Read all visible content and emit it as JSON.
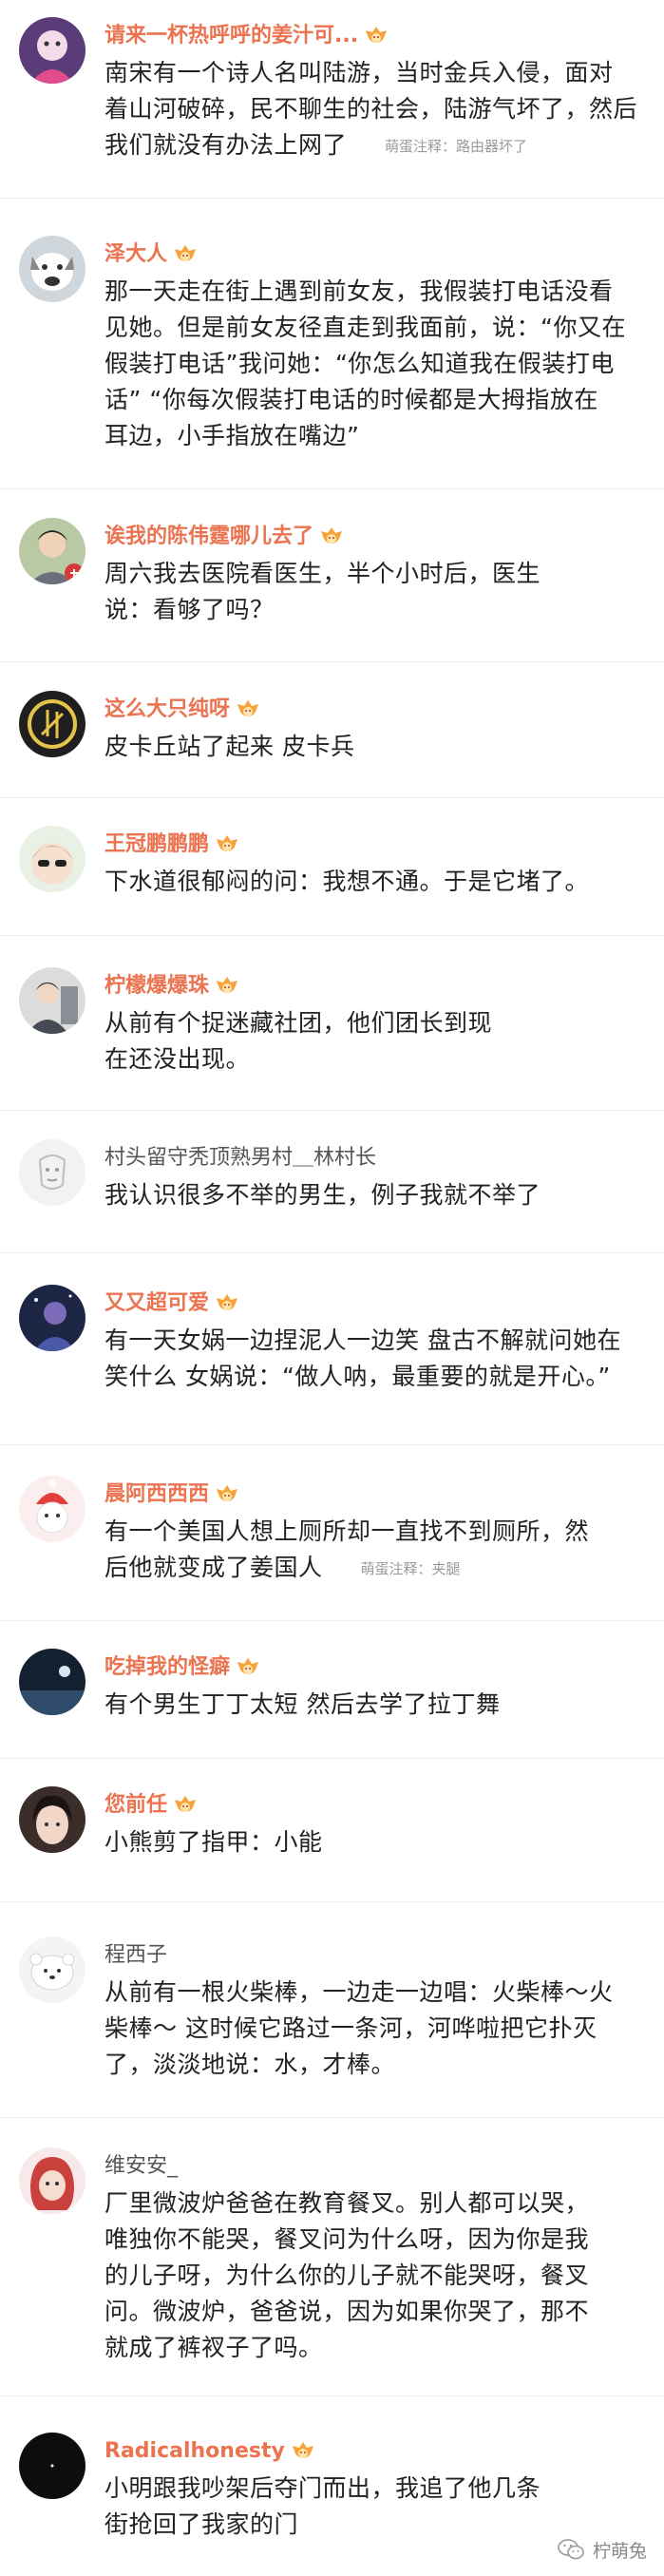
{
  "colors": {
    "vip_name": "#eb7350",
    "plain_name": "#555555",
    "body_text": "#222222",
    "note_text": "#9a9a9a",
    "watermark_text": "#888888"
  },
  "comments": [
    {
      "username": "请来一杯热呼呼的姜汁可...",
      "vip": true,
      "lines": [
        "南宋有一个诗人名叫陆游，当时金兵入侵，面对",
        "着山河破碎，民不聊生的社会，陆游气坏了，然后",
        "我们就没有办法上网了"
      ],
      "note": "萌蛋注释：路由器坏了"
    },
    {
      "username": "泽大人",
      "vip": true,
      "lines": [
        "那一天走在街上遇到前女友，我假装打电话没看",
        "见她。但是前女友径直走到我面前，说：“你又在",
        "假装打电话”我问她：“你怎么知道我在假装打电",
        "话” “你每次假装打电话的时候都是大拇指放在",
        "耳边，小手指放在嘴边”"
      ]
    },
    {
      "username": "诶我的陈伟霆哪儿去了",
      "vip": true,
      "lines": [
        "周六我去医院看医生，半个小时后，医生",
        "说：看够了吗？"
      ]
    },
    {
      "username": "这么大只纯呀",
      "vip": true,
      "lines": [
        "皮卡丘站了起来  皮卡兵"
      ]
    },
    {
      "username": "王冠鹏鹏鹏",
      "vip": true,
      "lines": [
        "下水道很郁闷的问：我想不通。于是它堵了。"
      ]
    },
    {
      "username": "柠檬爆爆珠",
      "vip": true,
      "lines": [
        "从前有个捉迷藏社团，他们团长到现",
        "在还没出现。"
      ]
    },
    {
      "username": "村头留守秃顶熟男村＿林村长",
      "vip": false,
      "lines": [
        "我认识很多不举的男生，例子我就不举了"
      ]
    },
    {
      "username": "又又超可爱",
      "vip": true,
      "lines": [
        "有一天女娲一边捏泥人一边笑 盘古不解就问她在",
        "笑什么 女娲说：“做人呐，最重要的就是开心。”"
      ]
    },
    {
      "username": "晨阿西西西",
      "vip": true,
      "lines": [
        "有一个美国人想上厕所却一直找不到厕所，然",
        "后他就变成了姜国人"
      ],
      "note": "萌蛋注释：夹腿"
    },
    {
      "username": "吃掉我的怪癖",
      "vip": true,
      "lines": [
        "有个男生丁丁太短 然后去学了拉丁舞"
      ]
    },
    {
      "username": "您前任",
      "vip": true,
      "lines": [
        "小熊剪了指甲：小能"
      ]
    },
    {
      "username": "程西子",
      "vip": false,
      "lines": [
        "从前有一根火柴棒，一边走一边唱：火柴棒～火",
        "柴棒～ 这时候它路过一条河，河哗啦把它扑灭",
        "了，淡淡地说：水，才棒。"
      ]
    },
    {
      "username": "维安安_",
      "vip": false,
      "lines": [
        "厂里微波炉爸爸在教育餐叉。别人都可以哭，",
        "唯独你不能哭，餐叉问为什么呀，因为你是我",
        "的儿子呀，为什么你的儿子就不能哭呀，餐叉",
        "问。微波炉，爸爸说，因为如果你哭了，那不",
        "就成了裤衩子了吗。"
      ]
    },
    {
      "username": "Radicalhonesty",
      "vip": true,
      "lines": [
        "小明跟我吵架后夺门而出，我追了他几条",
        "街抢回了我家的门"
      ]
    }
  ],
  "watermark": {
    "label": "柠萌兔",
    "icon": "wechat-icon"
  }
}
